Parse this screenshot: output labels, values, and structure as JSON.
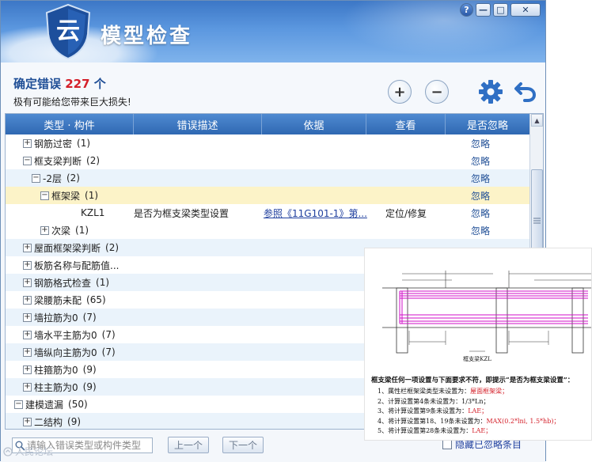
{
  "window": {
    "app_title": "模型检查",
    "logo_char": "云",
    "buttons": {
      "help": "?",
      "minimize": "—",
      "restore": "□",
      "close": "✕"
    }
  },
  "summary": {
    "error_prefix": "确定错误",
    "error_count": "227",
    "error_suffix": "个",
    "warning": "极有可能给您带来巨大损失!",
    "zoom_in_label": "+",
    "zoom_out_label": "−"
  },
  "table": {
    "columns": [
      "类型 · 构件",
      "错误描述",
      "依据",
      "查看",
      "是否忽略"
    ],
    "rows": [
      {
        "indent": 0,
        "expander": "+",
        "name": "钢筋过密",
        "count": "(1)",
        "ignore": "忽略",
        "style": ""
      },
      {
        "indent": 0,
        "expander": "−",
        "name": "框支梁判断",
        "count": "(2)",
        "ignore": "忽略",
        "style": ""
      },
      {
        "indent": 1,
        "expander": "−",
        "name": "-2层",
        "count": "(2)",
        "ignore": "忽略",
        "style": "alt"
      },
      {
        "indent": 2,
        "expander": "−",
        "name": "框架梁",
        "count": "(1)",
        "ignore": "忽略",
        "style": "sel"
      },
      {
        "indent": 3,
        "expander": "",
        "name": "KZL1",
        "count": "",
        "desc": "是否为框支梁类型设置",
        "basis": "参照《11G101-1》第...",
        "view": "定位/修复",
        "ignore": "忽略",
        "style": ""
      },
      {
        "indent": 2,
        "expander": "+",
        "name": "次梁",
        "count": "(1)",
        "ignore": "忽略",
        "style": ""
      },
      {
        "indent": 0,
        "expander": "+",
        "name": "屋面框架梁判断",
        "count": "(2)",
        "ignore": "",
        "style": "alt"
      },
      {
        "indent": 0,
        "expander": "+",
        "name": "板筋名称与配筋值...",
        "count": "",
        "ignore": "",
        "style": ""
      },
      {
        "indent": 0,
        "expander": "+",
        "name": "钢筋格式检查",
        "count": "(1)",
        "ignore": "",
        "style": "alt"
      },
      {
        "indent": 0,
        "expander": "+",
        "name": "梁腰筋未配",
        "count": "(65)",
        "ignore": "",
        "style": ""
      },
      {
        "indent": 0,
        "expander": "+",
        "name": "墙拉筋为0",
        "count": "(7)",
        "ignore": "",
        "style": "alt"
      },
      {
        "indent": 0,
        "expander": "+",
        "name": "墙水平主筋为0",
        "count": "(7)",
        "ignore": "",
        "style": ""
      },
      {
        "indent": 0,
        "expander": "+",
        "name": "墙纵向主筋为0",
        "count": "(7)",
        "ignore": "",
        "style": "alt"
      },
      {
        "indent": 0,
        "expander": "+",
        "name": "柱箍筋为0",
        "count": "(9)",
        "ignore": "",
        "style": ""
      },
      {
        "indent": 0,
        "expander": "+",
        "name": "柱主筋为0",
        "count": "(9)",
        "ignore": "",
        "style": "alt"
      },
      {
        "indent": -1,
        "expander": "−",
        "name": "建模遗漏",
        "count": "(50)",
        "ignore": "",
        "style": ""
      },
      {
        "indent": 0,
        "expander": "+",
        "name": "二结构",
        "count": "(9)",
        "ignore": "",
        "style": "alt"
      }
    ]
  },
  "footer": {
    "search_placeholder": "请输入错误类型或构件类型",
    "prev_label": "上一个",
    "next_label": "下一个",
    "hide_ignored_label": "隐藏已忽略条目",
    "watermark": "人民论坛"
  },
  "overlay": {
    "drawing_label": "框支梁KZL",
    "note_title": "框支梁任何一项设置与下面要求不符，即提示“是否为框支梁设置”：",
    "notes": [
      {
        "prefix": "1、属性栏框架梁类型未设置为：",
        "value": "屋面框架梁；"
      },
      {
        "prefix": "2、计算设置第4条未设置为：1/3*Ln；",
        "value": ""
      },
      {
        "prefix": "3、将计算设置第9条未设置为：",
        "value": "LAE；"
      },
      {
        "prefix": "4、将计算设置第18、19条未设置为：",
        "value": "MAX(0.2*lni, 1.5*hb)；"
      },
      {
        "prefix": "5、将计算设置第28条未设置为：",
        "value": "LAE；"
      }
    ]
  }
}
